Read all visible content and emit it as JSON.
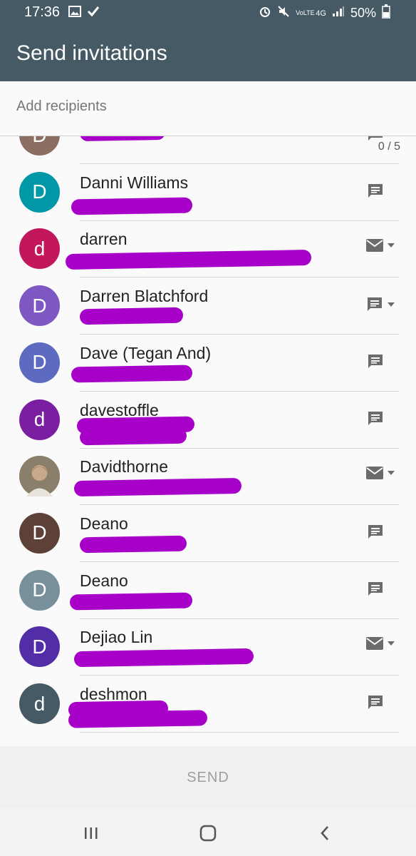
{
  "status_bar": {
    "time": "17:36",
    "battery": "50%",
    "network": "4G",
    "lte_label": "VoLTE"
  },
  "app_bar": {
    "title": "Send invitations"
  },
  "recipients": {
    "placeholder": "Add recipients",
    "counter": "0 / 5"
  },
  "contacts": [
    {
      "name": "",
      "initial": "D",
      "color": "#8d6e63",
      "action": "message-icon",
      "partial": true
    },
    {
      "name": "Danni Williams",
      "initial": "D",
      "color": "#0097a7",
      "action": "message-icon"
    },
    {
      "name": "darren",
      "initial": "d",
      "color": "#c2185b",
      "action": "email-icon"
    },
    {
      "name": "Darren Blatchford",
      "initial": "D",
      "color": "#7e57c2",
      "action": "message-icon"
    },
    {
      "name": "Dave (Tegan And)",
      "initial": "D",
      "color": "#5c6bc0",
      "action": "message-icon"
    },
    {
      "name": "davestoffle",
      "initial": "d",
      "color": "#7b1fa2",
      "action": "message-icon"
    },
    {
      "name": "Davidthorne",
      "initial": "",
      "color": "#8a7f6a",
      "action": "email-icon",
      "photo": true
    },
    {
      "name": "Deano",
      "initial": "D",
      "color": "#5d4037",
      "action": "message-icon"
    },
    {
      "name": "Deano",
      "initial": "D",
      "color": "#78909c",
      "action": "message-icon"
    },
    {
      "name": "Dejiao Lin",
      "initial": "D",
      "color": "#512da8",
      "action": "email-icon"
    },
    {
      "name": "deshmon",
      "initial": "d",
      "color": "#455a64",
      "action": "message-icon"
    }
  ],
  "send_button": {
    "label": "SEND"
  },
  "nav": {
    "recents": "recents-icon",
    "home": "home-icon",
    "back": "back-icon"
  }
}
